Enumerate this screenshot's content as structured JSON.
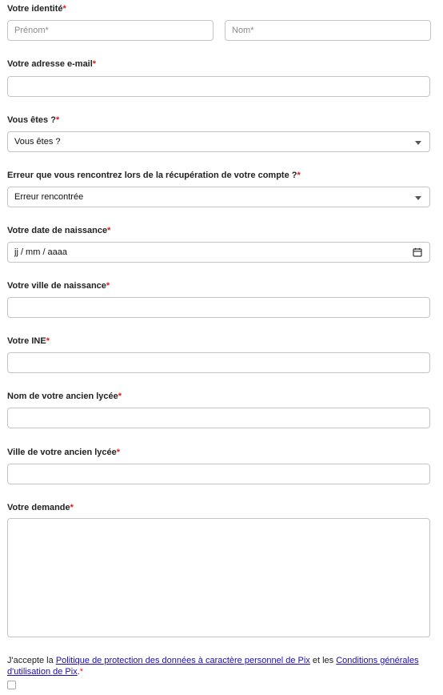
{
  "identity": {
    "label": "Votre identité",
    "firstname_placeholder": "Prénom*",
    "lastname_placeholder": "Nom*"
  },
  "email": {
    "label": "Votre adresse e-mail",
    "value": ""
  },
  "user_type": {
    "label": "Vous êtes ?",
    "selected": "Vous êtes ?"
  },
  "error_type": {
    "label": "Erreur que vous rencontrez lors de la récupération de votre compte ?",
    "selected": "Erreur rencontrée"
  },
  "birthdate": {
    "label": "Votre date de naissance",
    "placeholder": "jj / mm / aaaa"
  },
  "birth_city": {
    "label": "Votre ville de naissance"
  },
  "ine": {
    "label": "Votre INE"
  },
  "school_name": {
    "label": "Nom de votre ancien lycée"
  },
  "school_city": {
    "label": "Ville de votre ancien lycée"
  },
  "request": {
    "label": "Votre demande"
  },
  "consent": {
    "prefix": "J'accepte la ",
    "privacy_link": "Politique de protection des données à caractère personnel de Pix",
    "middle": " et les ",
    "terms_link": "Conditions générales d'utilisation de Pix",
    "suffix": "."
  },
  "required_mark": "*",
  "colors": {
    "required": "#d41f1f",
    "link": "#1a0dab",
    "border": "#c4c4c4"
  },
  "icons": {
    "select": "chevron-down-icon",
    "date": "calendar-icon"
  }
}
